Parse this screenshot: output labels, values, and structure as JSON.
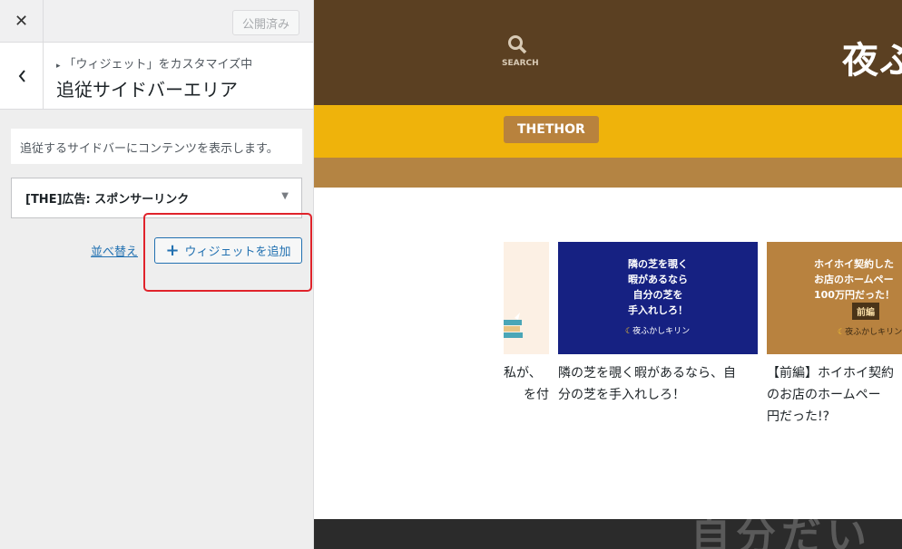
{
  "panel": {
    "close_icon": "close-icon",
    "publish_label": "公開済み",
    "breadcrumb": "「ウィジェット」をカスタマイズ中",
    "title": "追従サイドバーエリア",
    "description": "追従するサイドバーにコンテンツを表示します。",
    "widget_label": "[THE]広告: スポンサーリンク",
    "reorder_label": "並べ替え",
    "add_widget_label": "ウィジェットを追加"
  },
  "preview": {
    "search_label": "SEARCH",
    "logo_text": "夜ふ",
    "nav_item": "THETHOR",
    "footer_text": "自分だい",
    "cards": [
      {
        "image_text": "",
        "title_lines": [
          "私が、",
          "を付"
        ]
      },
      {
        "image_text": "隣の芝を覗く\n暇があるなら\n自分の芝を\n手入れしろ！",
        "badge": "夜ふかしキリン",
        "title_lines": [
          "隣の芝を覗く暇があるなら、自",
          "分の芝を手入れしろ！"
        ]
      },
      {
        "image_text": "ホイホイ契約した\nお店のホームペー\n100万円だった！",
        "badge_top": "前編",
        "badge": "夜ふかしキリン",
        "title_lines": [
          "【前編】ホイホイ契約",
          "のお店のホームペー",
          "円だった!?"
        ]
      }
    ]
  },
  "colors": {
    "header_bg": "#5b4022",
    "nav_bg": "#efb30b",
    "accent": "#2271b1",
    "highlight": "#e0232b"
  }
}
